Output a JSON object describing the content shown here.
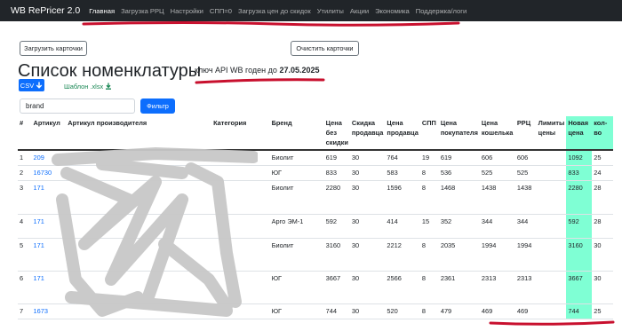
{
  "navbar": {
    "brand": "WB RePricer 2.0",
    "links": [
      {
        "label": "Главная",
        "active": true
      },
      {
        "label": "Загрузка РРЦ"
      },
      {
        "label": "Настройки"
      },
      {
        "label": "СПП=0"
      },
      {
        "label": "Загрузка цен до скидок"
      },
      {
        "label": "Утилиты"
      },
      {
        "label": "Акции"
      },
      {
        "label": "Экономика"
      },
      {
        "label": "Поддержка/логи"
      }
    ]
  },
  "buttons": {
    "upload_cards": "Загрузить карточки",
    "clear_cards": "Очистить карточки",
    "csv": "CSV",
    "template": "Шаблон .xlsx",
    "filter": "Фильтр"
  },
  "page": {
    "title": "Список номенклатуры",
    "api_text": "ключ API WB годен до",
    "api_date": "27.05.2025"
  },
  "filter": {
    "value": "brand"
  },
  "table": {
    "headers": [
      "#",
      "Артикул",
      "Артикул производителя",
      "Категория",
      "Бренд",
      "Цена без скидки",
      "Скидка продавца",
      "Цена продавца",
      "СПП",
      "Цена покупателя",
      "Цена кошелька",
      "РРЦ",
      "Лимиты цены",
      "Новая цена",
      "кол-во"
    ],
    "rows": [
      {
        "n": "1",
        "art": "209",
        "maker": "",
        "cat": "",
        "brand": "Биолит",
        "price": "619",
        "disc": "30",
        "seller": "764",
        "spp": "19",
        "buyer": "619",
        "wallet": "606",
        "rrc": "606",
        "limit": "",
        "new": "1092",
        "qty": "25"
      },
      {
        "n": "2",
        "art": "16730",
        "maker": "",
        "cat": "",
        "brand": "ЮГ",
        "price": "833",
        "disc": "30",
        "seller": "583",
        "spp": "8",
        "buyer": "536",
        "wallet": "525",
        "rrc": "525",
        "limit": "",
        "new": "833",
        "qty": "24"
      },
      {
        "n": "3",
        "art": "171",
        "maker": "",
        "cat": "",
        "brand": "Биолит",
        "price": "2280",
        "disc": "30",
        "seller": "1596",
        "spp": "8",
        "buyer": "1468",
        "wallet": "1438",
        "rrc": "1438",
        "limit": "",
        "new": "2280",
        "qty": "28"
      },
      {
        "n": "4",
        "art": "171",
        "maker": "",
        "cat": "",
        "brand": "Арго ЭМ-1",
        "price": "592",
        "disc": "30",
        "seller": "414",
        "spp": "15",
        "buyer": "352",
        "wallet": "344",
        "rrc": "344",
        "limit": "",
        "new": "592",
        "qty": "28"
      },
      {
        "n": "5",
        "art": "171",
        "maker": "",
        "cat": "",
        "brand": "Биолит",
        "price": "3160",
        "disc": "30",
        "seller": "2212",
        "spp": "8",
        "buyer": "2035",
        "wallet": "1994",
        "rrc": "1994",
        "limit": "",
        "new": "3160",
        "qty": "30"
      },
      {
        "n": "6",
        "art": "171",
        "maker": "",
        "cat": "",
        "brand": "ЮГ",
        "price": "3667",
        "disc": "30",
        "seller": "2566",
        "spp": "8",
        "buyer": "2361",
        "wallet": "2313",
        "rrc": "2313",
        "limit": "",
        "new": "3667",
        "qty": "30"
      },
      {
        "n": "7",
        "art": "1673",
        "maker": "",
        "cat": "",
        "brand": "ЮГ",
        "price": "744",
        "disc": "30",
        "seller": "520",
        "spp": "8",
        "buyer": "479",
        "wallet": "469",
        "rrc": "469",
        "limit": "",
        "new": "744",
        "qty": "25"
      }
    ]
  },
  "colors": {
    "navbar": "#212529",
    "primary": "#0d6efd",
    "highlight": "#7fffd4",
    "annotation": "#c8102e",
    "template_link": "#198754",
    "scribble": "#c8c8c8"
  }
}
